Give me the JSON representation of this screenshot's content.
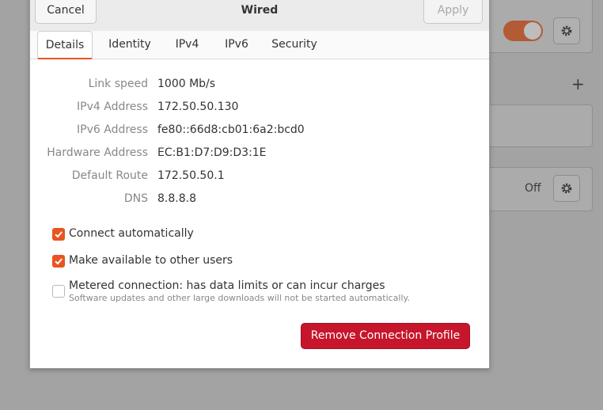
{
  "dialog": {
    "title": "Wired",
    "cancel_label": "Cancel",
    "apply_label": "Apply"
  },
  "tabs": [
    {
      "label": "Details",
      "active": true
    },
    {
      "label": "Identity",
      "active": false
    },
    {
      "label": "IPv4",
      "active": false
    },
    {
      "label": "IPv6",
      "active": false
    },
    {
      "label": "Security",
      "active": false
    }
  ],
  "details": [
    {
      "label": "Link speed",
      "value": "1000 Mb/s"
    },
    {
      "label": "IPv4 Address",
      "value": "172.50.50.130"
    },
    {
      "label": "IPv6 Address",
      "value": "fe80::66d8:cb01:6a2:bcd0"
    },
    {
      "label": "Hardware Address",
      "value": "EC:B1:D7:D9:D3:1E"
    },
    {
      "label": "Default Route",
      "value": "172.50.50.1"
    },
    {
      "label": "DNS",
      "value": "8.8.8.8"
    }
  ],
  "options": {
    "connect_automatically": {
      "label": "Connect automatically",
      "checked": true
    },
    "available_to_others": {
      "label": "Make available to other users",
      "checked": true
    },
    "metered": {
      "label": "Metered connection: has data limits or can incur charges",
      "sublabel": "Software updates and other large downloads will not be started automatically.",
      "checked": false
    }
  },
  "remove_label": "Remove Connection Profile",
  "background": {
    "toggle_on": true,
    "off_label": "Off",
    "plus_symbol": "+"
  },
  "colors": {
    "accent": "#e95420",
    "destructive": "#c7162b"
  },
  "icons": [
    "gear-icon",
    "checkmark-icon",
    "plus-icon"
  ]
}
